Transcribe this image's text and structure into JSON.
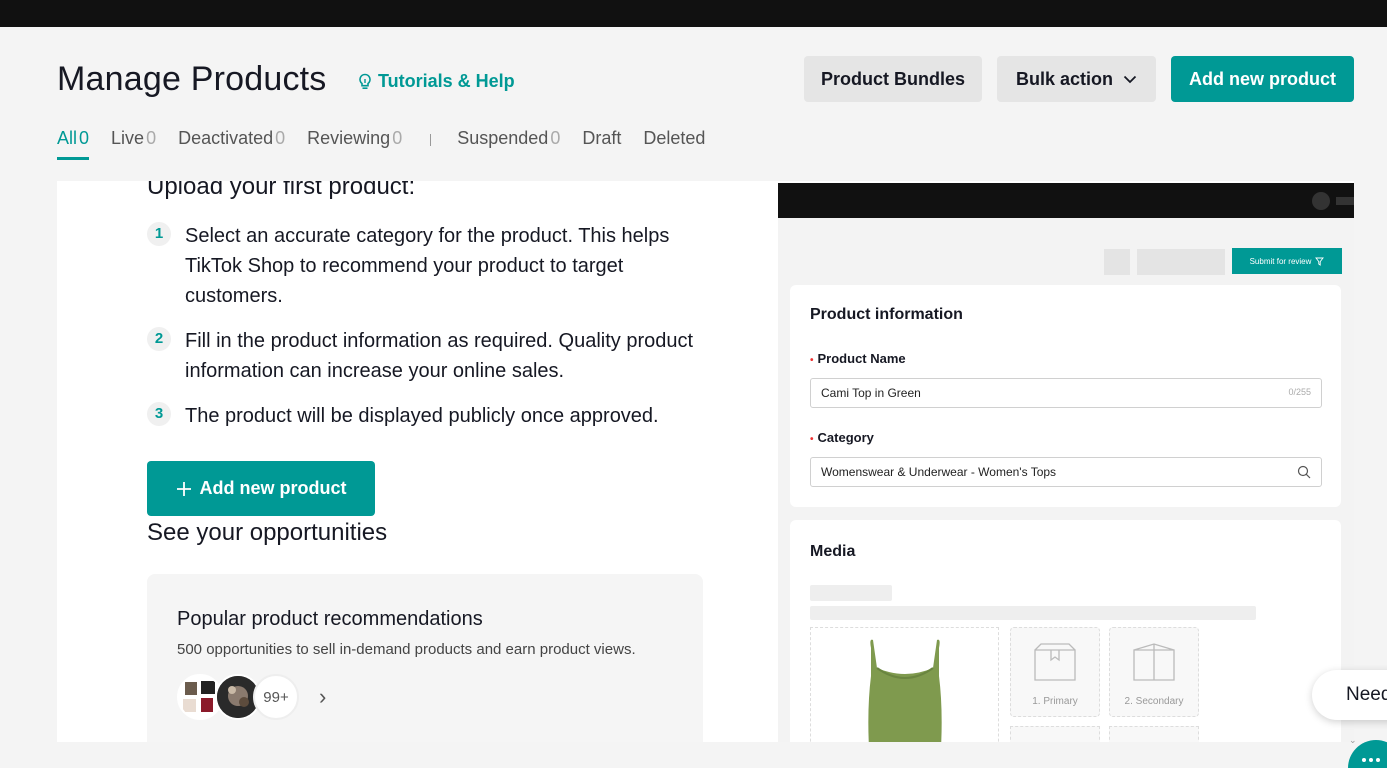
{
  "header": {
    "title": "Manage Products",
    "tutorials_label": "Tutorials & Help",
    "product_bundles_label": "Product Bundles",
    "bulk_action_label": "Bulk action",
    "add_new_product_label": "Add new product"
  },
  "tabs": [
    {
      "label": "All",
      "count": "0"
    },
    {
      "label": "Live",
      "count": "0"
    },
    {
      "label": "Deactivated",
      "count": "0"
    },
    {
      "label": "Reviewing",
      "count": "0"
    },
    {
      "label": "Suspended",
      "count": "0"
    },
    {
      "label": "Draft",
      "count": ""
    },
    {
      "label": "Deleted",
      "count": ""
    }
  ],
  "upload": {
    "title": "Upload your first product:",
    "steps": [
      {
        "num": "1",
        "text": "Select an accurate category for the product. This helps TikTok Shop to recommend your product to target customers."
      },
      {
        "num": "2",
        "text": "Fill in the product information as required. Quality product information can increase your online sales."
      },
      {
        "num": "3",
        "text": "The product will be displayed publicly once approved."
      }
    ],
    "add_button_label": "Add new product"
  },
  "opportunities": {
    "title": "See your opportunities",
    "card_title": "Popular product recommendations",
    "card_desc": "500 opportunities to sell in-demand products and earn product views.",
    "more_count": "99+"
  },
  "preview": {
    "submit_label": "Submit for review",
    "product_info_title": "Product information",
    "product_name_label": "Product Name",
    "product_name_value": "Cami Top in Green",
    "product_name_count": "0/255",
    "category_label": "Category",
    "category_value": "Womenswear & Underwear - Women's Tops",
    "media_title": "Media",
    "slot_primary": "1. Primary",
    "slot_secondary": "2. Secondary"
  },
  "help": {
    "need_help_label": "Need"
  },
  "colors": {
    "accent": "#009995",
    "topbar": "#111111"
  }
}
